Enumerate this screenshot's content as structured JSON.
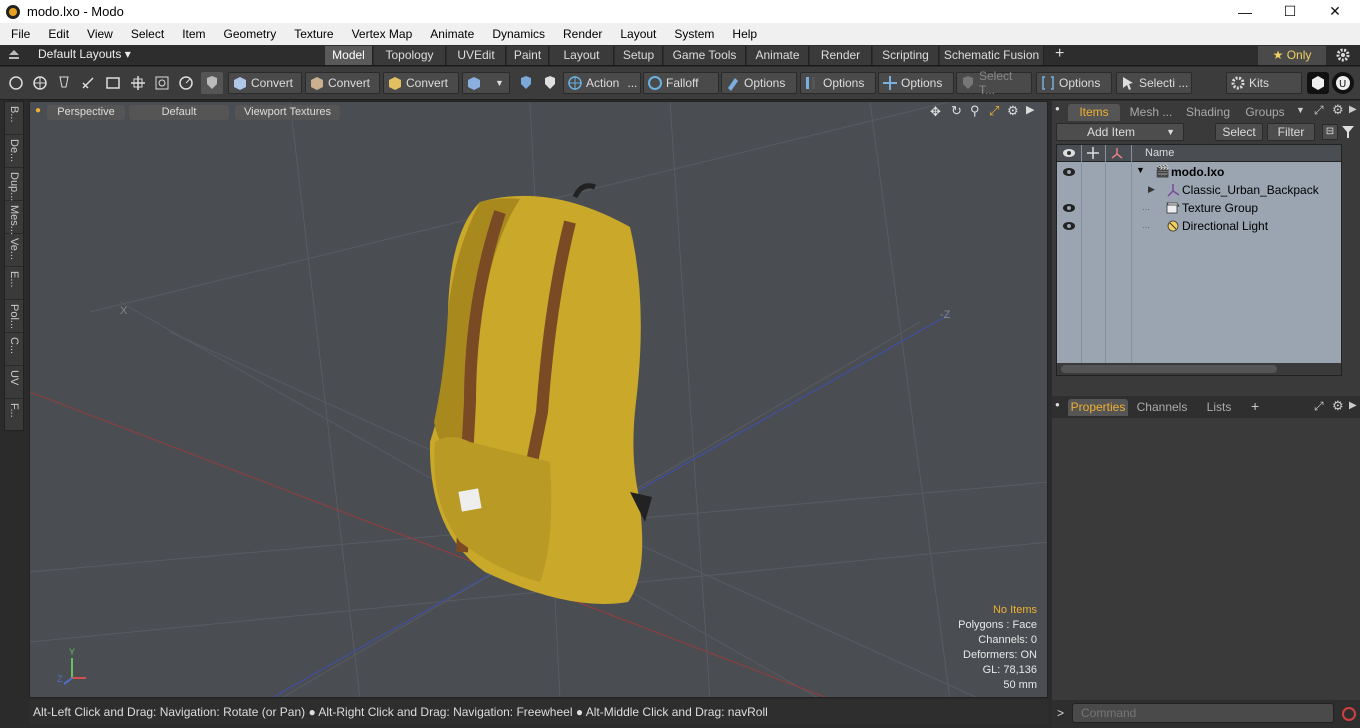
{
  "window": {
    "title": "modo.lxo - Modo",
    "minimize": "—",
    "maximize": "☐",
    "close": "✕"
  },
  "menu": [
    "File",
    "Edit",
    "View",
    "Select",
    "Item",
    "Geometry",
    "Texture",
    "Vertex Map",
    "Animate",
    "Dynamics",
    "Render",
    "Layout",
    "System",
    "Help"
  ],
  "layouts": {
    "dropdown": "Default Layouts ▾",
    "tabs": [
      "Model",
      "Topology",
      "UVEdit",
      "Paint",
      "Layout",
      "Setup",
      "Game Tools",
      "Animate",
      "Render",
      "Scripting",
      "Schematic Fusion"
    ],
    "active_tab": "Model",
    "add": "+",
    "only": "★ Only",
    "settings_icon": "gear-icon"
  },
  "toolbar": {
    "convert1": "Convert",
    "convert2": "Convert",
    "convert3": "Convert",
    "action": "Action",
    "action_more": "...",
    "falloff": "Falloff",
    "options1": "Options",
    "options2": "Options",
    "options3": "Options",
    "select_t": "Select T...",
    "options4": "Options",
    "selecti": "Selecti ...",
    "kits": "Kits"
  },
  "left_tabs": [
    "B...",
    "De...",
    "Dup...",
    "Mes...",
    "Ve...",
    "E...",
    "Pol...",
    "C...",
    "UV",
    "F..."
  ],
  "viewport": {
    "view": "Perspective",
    "style": "Default",
    "textures": "Viewport Textures",
    "info": {
      "no_items": "No Items",
      "polygons": "Polygons : Face",
      "channels": "Channels: 0",
      "deformers": "Deformers: ON",
      "gl": "GL: 78,136",
      "lens": "50 mm"
    },
    "axis_x": "X",
    "axis_z": "-Z",
    "gizmo_y": "Y",
    "gizmo_z": "Z"
  },
  "status": "Alt-Left Click and Drag: Navigation: Rotate (or Pan) ● Alt-Right Click and Drag: Navigation: Freewheel ● Alt-Middle Click and Drag: navRoll",
  "items_panel": {
    "tabs": [
      "Items",
      "Mesh ...",
      "Shading",
      "Groups"
    ],
    "active_tab": "Items",
    "add_item": "Add Item",
    "select": "Select",
    "filter": "Filter",
    "col_name": "Name",
    "rows": [
      {
        "name": "modo.lxo",
        "bold": true,
        "visible": true
      },
      {
        "name": "Classic_Urban_Backpack",
        "bold": false,
        "visible": false
      },
      {
        "name": "Texture Group",
        "bold": false,
        "visible": true
      },
      {
        "name": "Directional Light",
        "bold": false,
        "visible": true
      }
    ]
  },
  "props_panel": {
    "tabs": [
      "Properties",
      "Channels",
      "Lists"
    ],
    "active_tab": "Properties",
    "add": "+"
  },
  "command": {
    "prompt": ">",
    "placeholder": "Command"
  },
  "colors": {
    "accent": "#f0b030",
    "viewport_bg": "#4a4d52",
    "item_list_bg": "#9aa5b1",
    "backpack": "#c9a82a",
    "straps": "#7a4a25"
  }
}
